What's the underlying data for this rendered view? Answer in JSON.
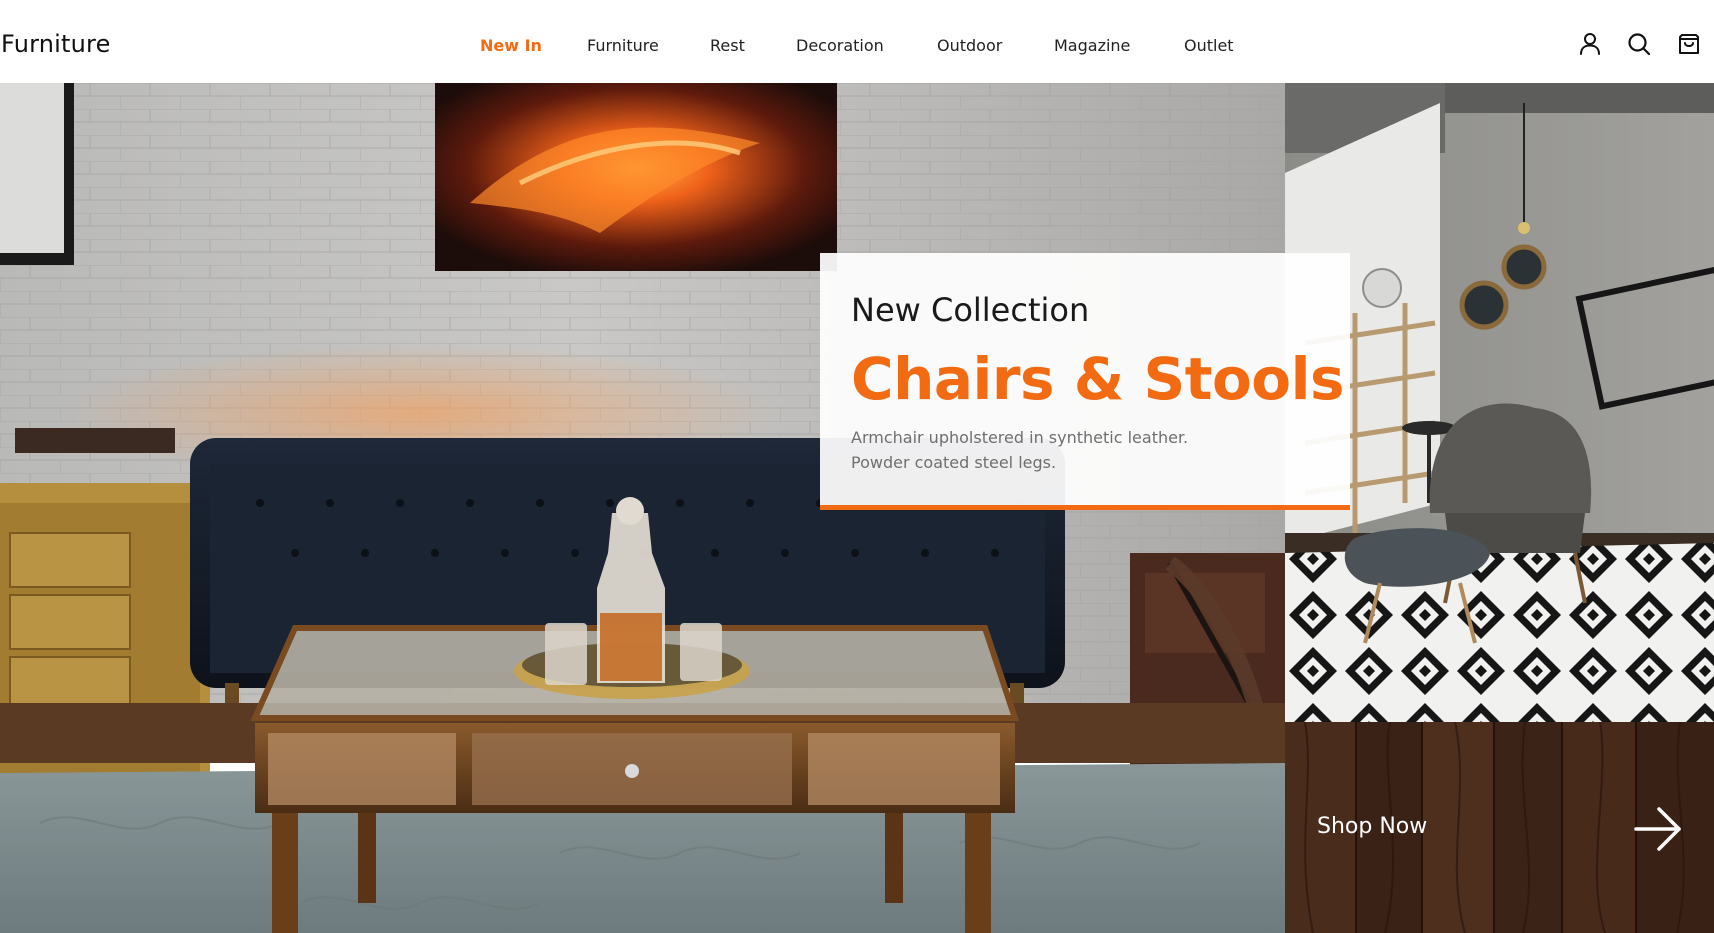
{
  "brand": {
    "name": "Furniture"
  },
  "nav": {
    "items": [
      {
        "label": "New In",
        "active": true
      },
      {
        "label": "Furniture",
        "active": false
      },
      {
        "label": "Rest",
        "active": false
      },
      {
        "label": "Decoration",
        "active": false
      },
      {
        "label": "Outdoor",
        "active": false
      },
      {
        "label": "Magazine",
        "active": false
      },
      {
        "label": "Outlet",
        "active": false
      }
    ]
  },
  "header_icons": [
    "user-icon",
    "search-icon",
    "shopping-bag-icon"
  ],
  "promo": {
    "eyebrow": "New Collection",
    "title": "Chairs & Stools",
    "description": [
      "Armchair upholstered in synthetic leather.",
      "Powder coated steel legs."
    ]
  },
  "cta": {
    "label": "Shop Now",
    "icon": "arrow-right-icon"
  },
  "colors": {
    "accent": "#f26a12",
    "text": "#111111",
    "muted": "#6f6f6f",
    "background": "#ffffff"
  }
}
